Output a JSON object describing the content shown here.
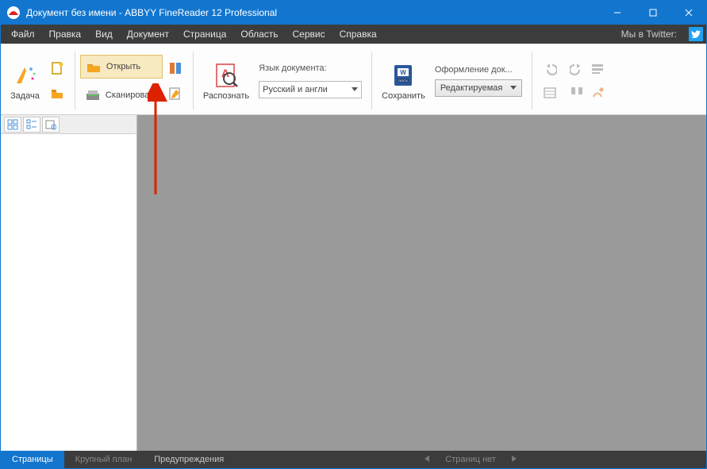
{
  "title": "Документ без имени - ABBYY FineReader 12 Professional",
  "menu": {
    "file": "Файл",
    "edit": "Правка",
    "view": "Вид",
    "document": "Документ",
    "page": "Страница",
    "area": "Область",
    "service": "Сервис",
    "help": "Справка",
    "twitter": "Мы в Twitter:"
  },
  "ribbon": {
    "task": "Задача",
    "open": "Открыть",
    "scan": "Сканировать",
    "recognize": "Распознать",
    "lang_label": "Язык документа:",
    "lang_value": "Русский и англи",
    "save": "Сохранить",
    "layout_label": "Оформление док...",
    "layout_value": "Редактируемая"
  },
  "status": {
    "pages": "Страницы",
    "zoom": "Крупный план",
    "warnings": "Предупреждения",
    "nopages": "Страниц нет"
  }
}
